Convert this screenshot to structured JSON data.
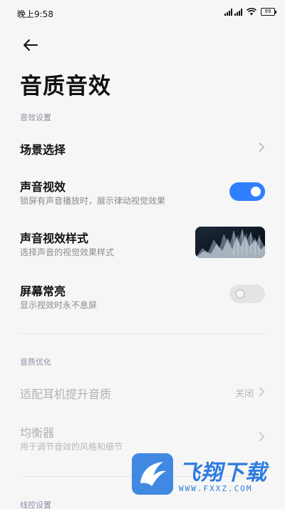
{
  "status_bar": {
    "time": "晚上9:58",
    "battery": "99",
    "icons": [
      "signal-icon",
      "wifi-icon",
      "battery-icon"
    ]
  },
  "page_title": "音质音效",
  "sections": {
    "effects": "音效设置",
    "quality": "音质优化",
    "wire": "线控设置"
  },
  "rows": {
    "scene": {
      "title": "场景选择"
    },
    "visual": {
      "title": "声音视效",
      "subtitle": "锁屏有声音播放时，展示律动视觉效果",
      "enabled": true
    },
    "visual_style": {
      "title": "声音视效样式",
      "subtitle": "选择声音的视觉效果样式"
    },
    "always_on": {
      "title": "屏幕常亮",
      "subtitle": "显示视效时永不息屏",
      "enabled": false
    },
    "headphone": {
      "title": "适配耳机提升音质",
      "value": "关闭"
    },
    "equalizer": {
      "title": "均衡器",
      "subtitle": "用于调节音效的风格和细节"
    }
  },
  "watermark": {
    "name": "飞翔下载",
    "url": "WWW.FXXZ.COM"
  },
  "colors": {
    "accent": "#2f7fff",
    "background": "#f6f6f6",
    "section_label": "#8c8fa6"
  }
}
